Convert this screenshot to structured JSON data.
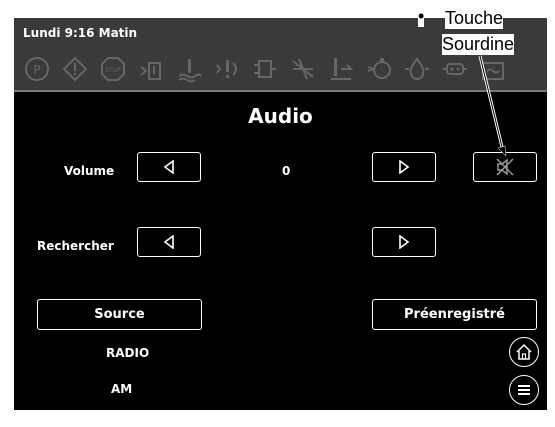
{
  "status": {
    "clock": "Lundi 9:16 Matin"
  },
  "toolbar": {
    "icons": [
      "park-brake-icon",
      "warning-icon",
      "stop-icon",
      "fuel-filter-icon",
      "coolant-temp-icon",
      "hydraulic-icon",
      "transmission-icon",
      "diff-lock-icon",
      "oil-level-icon",
      "fuel-icon",
      "engine-oil-icon",
      "dpf-icon",
      "battery-icon"
    ]
  },
  "page": {
    "title": "Audio"
  },
  "volume": {
    "label": "Volume",
    "value": "0"
  },
  "seek": {
    "label": "Rechercher"
  },
  "source": {
    "button_label": "Source",
    "line1": "RADIO",
    "line2": "AM"
  },
  "preset": {
    "button_label": "Préenregistré"
  },
  "callout": {
    "bullet": "•",
    "line1": "Touche",
    "line2": "Sourdine"
  }
}
